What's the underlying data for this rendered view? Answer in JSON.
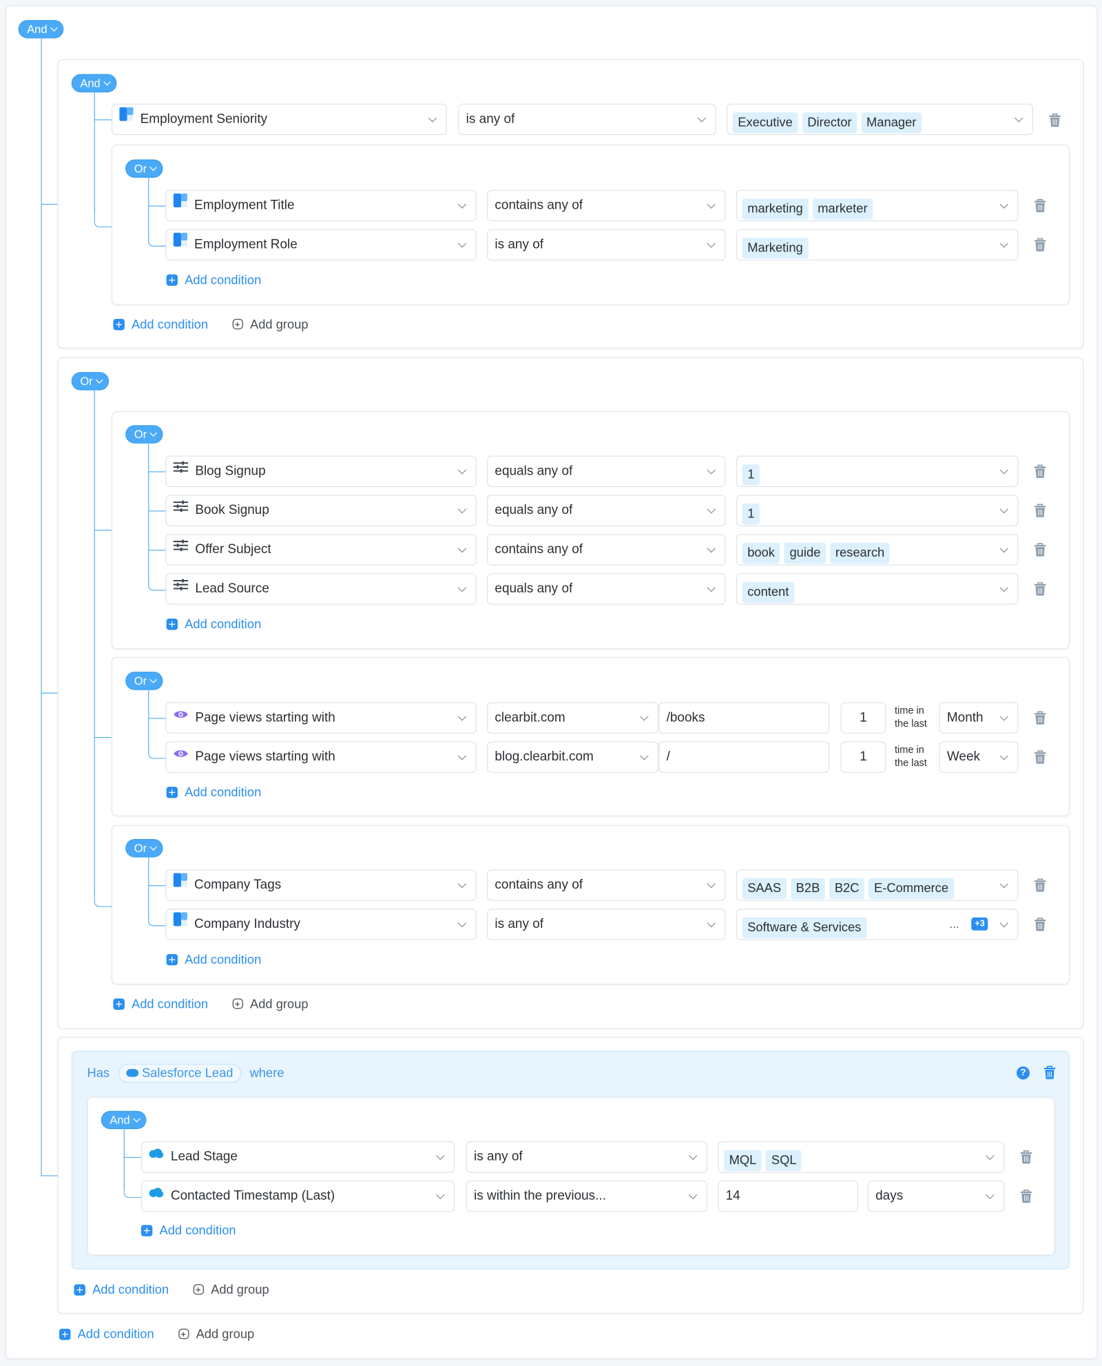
{
  "colors": {
    "accent": "#2a8ff0",
    "pill": "#4aaaf7",
    "tag_bg": "#dcf0fd",
    "has_bg": "#e8f5fe",
    "page_view_icon": "#8a6cf0"
  },
  "root": {
    "operator": "And"
  },
  "group1": {
    "operator": "And",
    "condition": {
      "icon": "clearbit-icon",
      "field": "Employment Seniority",
      "op": "is any of",
      "values": [
        "Executive",
        "Director",
        "Manager"
      ]
    },
    "subgroup": {
      "operator": "Or",
      "conditions": [
        {
          "icon": "clearbit-icon",
          "field": "Employment Title",
          "op": "contains any of",
          "values": [
            "marketing",
            "marketer"
          ]
        },
        {
          "icon": "clearbit-icon",
          "field": "Employment Role",
          "op": "is any of",
          "values": [
            "Marketing"
          ]
        }
      ],
      "add_condition": "Add condition"
    },
    "add_condition": "Add condition",
    "add_group": "Add group"
  },
  "group2": {
    "operator": "Or",
    "sub1": {
      "operator": "Or",
      "conditions": [
        {
          "icon": "sliders-icon",
          "field": "Blog Signup",
          "op": "equals any of",
          "values": [
            "1"
          ]
        },
        {
          "icon": "sliders-icon",
          "field": "Book Signup",
          "op": "equals any of",
          "values": [
            "1"
          ]
        },
        {
          "icon": "sliders-icon",
          "field": "Offer Subject",
          "op": "contains any of",
          "values": [
            "book",
            "guide",
            "research"
          ]
        },
        {
          "icon": "sliders-icon",
          "field": "Lead Source",
          "op": "equals any of",
          "values": [
            "content"
          ]
        }
      ],
      "add_condition": "Add condition"
    },
    "sub2": {
      "operator": "Or",
      "conditions": [
        {
          "icon": "eye-icon",
          "field": "Page views starting with",
          "domain": "clearbit.com",
          "path": "/books",
          "count": "1",
          "time_label_1": "time in",
          "time_label_2": "the last",
          "period": "Month"
        },
        {
          "icon": "eye-icon",
          "field": "Page views starting with",
          "domain": "blog.clearbit.com",
          "path": "/",
          "count": "1",
          "time_label_1": "time in",
          "time_label_2": "the last",
          "period": "Week"
        }
      ],
      "add_condition": "Add condition"
    },
    "sub3": {
      "operator": "Or",
      "conditions": [
        {
          "icon": "clearbit-icon",
          "field": "Company Tags",
          "op": "contains any of",
          "values": [
            "SAAS",
            "B2B",
            "B2C",
            "E-Commerce"
          ]
        },
        {
          "icon": "clearbit-icon",
          "field": "Company Industry",
          "op": "is any of",
          "values": [
            "Software & Services"
          ],
          "ellipsis": "...",
          "more": "+3"
        }
      ],
      "add_condition": "Add condition"
    },
    "add_condition": "Add condition",
    "add_group": "Add group"
  },
  "group3": {
    "has_label": "Has",
    "object": "Salesforce Lead",
    "where_label": "where",
    "inner": {
      "operator": "And",
      "conditions": [
        {
          "icon": "salesforce-icon",
          "field": "Lead Stage",
          "op": "is any of",
          "values": [
            "MQL",
            "SQL"
          ]
        },
        {
          "icon": "salesforce-icon",
          "field": "Contacted Timestamp (Last)",
          "op": "is within the previous...",
          "amount": "14",
          "unit": "days"
        }
      ],
      "add_condition": "Add condition"
    },
    "add_condition": "Add condition",
    "add_group": "Add group"
  },
  "footer": {
    "add_condition": "Add condition",
    "add_group": "Add group"
  }
}
